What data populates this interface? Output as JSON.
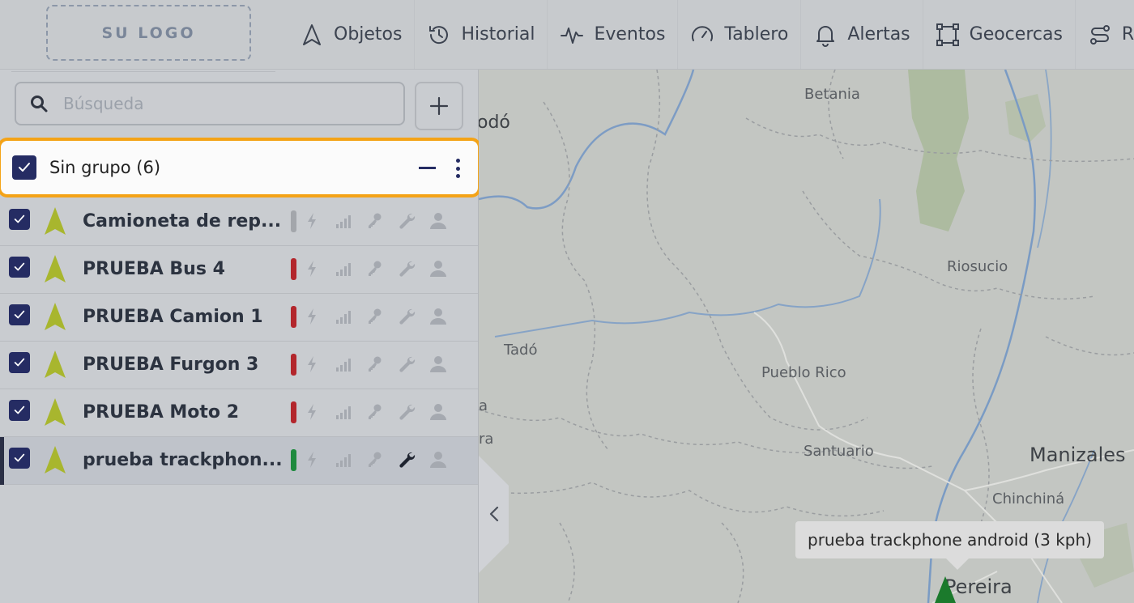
{
  "logo": {
    "text": "SU LOGO"
  },
  "nav": [
    {
      "label": "Objetos",
      "icon": "navigation-arrow-icon"
    },
    {
      "label": "Historial",
      "icon": "history-icon"
    },
    {
      "label": "Eventos",
      "icon": "activity-icon"
    },
    {
      "label": "Tablero",
      "icon": "gauge-icon"
    },
    {
      "label": "Alertas",
      "icon": "bell-icon"
    },
    {
      "label": "Geocercas",
      "icon": "geofence-icon"
    },
    {
      "label": "R",
      "icon": "route-icon"
    }
  ],
  "search": {
    "placeholder": "Búsqueda",
    "value": ""
  },
  "group": {
    "label": "Sin grupo (6)",
    "checked": true
  },
  "objects": [
    {
      "name": "Camioneta de rep...",
      "status_color": "#a3a6ab",
      "checked": true,
      "selected": false,
      "key_active": false
    },
    {
      "name": "PRUEBA Bus 4",
      "status_color": "#b3262c",
      "checked": true,
      "selected": false,
      "key_active": false
    },
    {
      "name": "PRUEBA Camion 1",
      "status_color": "#b3262c",
      "checked": true,
      "selected": false,
      "key_active": false
    },
    {
      "name": "PRUEBA Furgon 3",
      "status_color": "#b3262c",
      "checked": true,
      "selected": false,
      "key_active": false
    },
    {
      "name": "PRUEBA Moto 2",
      "status_color": "#b3262c",
      "checked": true,
      "selected": false,
      "key_active": false
    },
    {
      "name": "prueba trackphon...",
      "status_color": "#1e8a3e",
      "checked": true,
      "selected": true,
      "key_active": true
    }
  ],
  "map": {
    "places": [
      "Betania",
      "odó",
      "Riosucio",
      "Tadó",
      "Pueblo Rico",
      "Santuario",
      "Manizales",
      "Chinchiná",
      "Pereira",
      "a",
      "ra"
    ],
    "tooltip": "prueba trackphone android (3 kph)"
  },
  "colors": {
    "accent": "#252c63",
    "highlight_border": "#f4a317",
    "marker": "#1b7a2c",
    "object_arrow": "#a8b62e"
  }
}
